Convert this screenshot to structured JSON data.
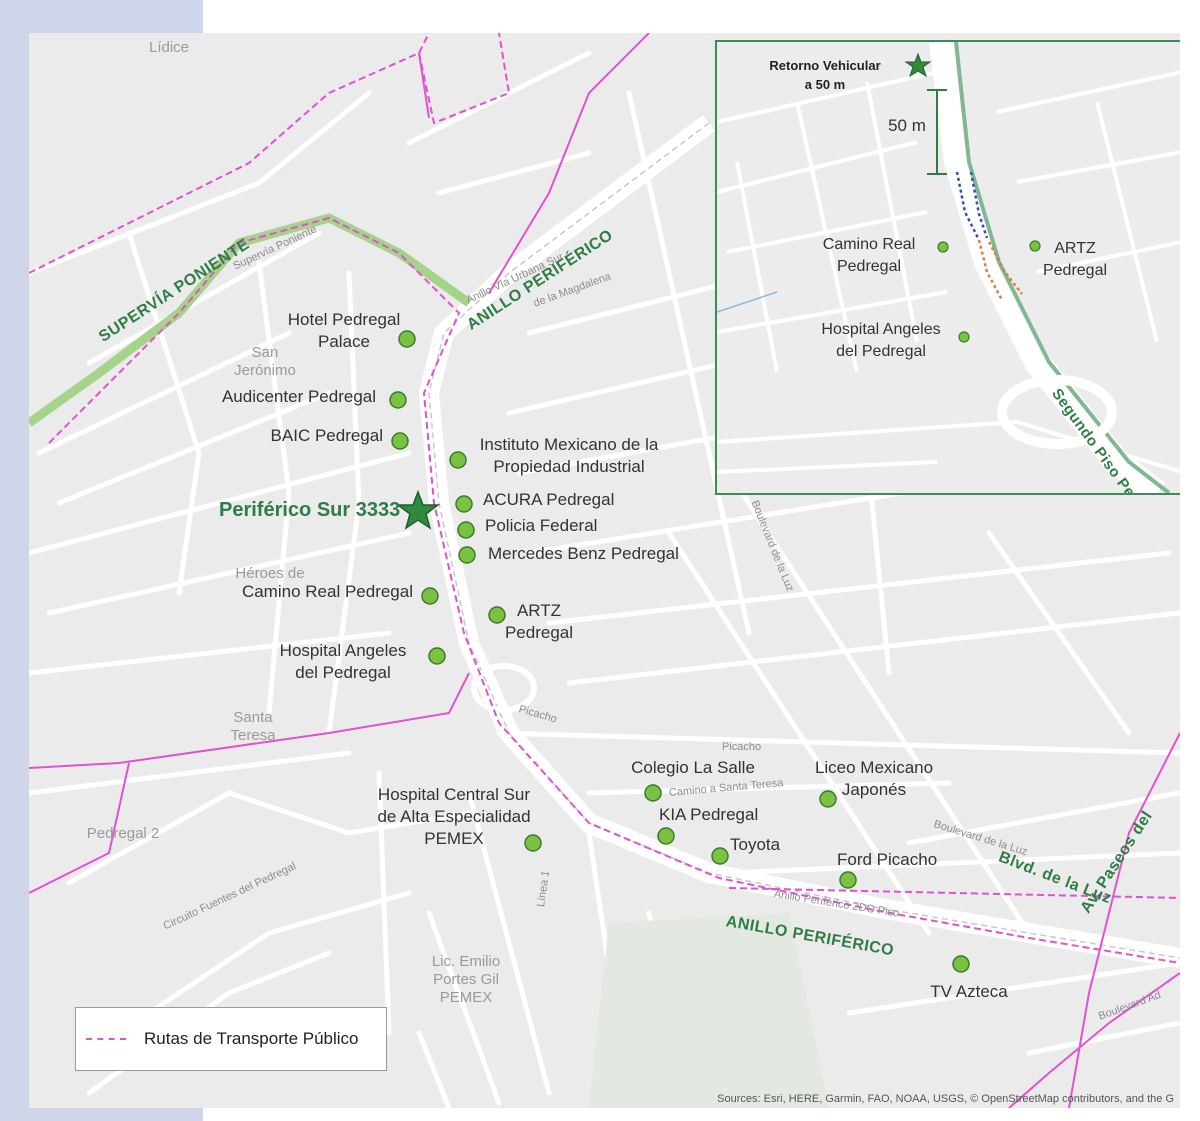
{
  "map": {
    "attribution": "Sources: Esri, HERE, Garmin, FAO, NOAA, USGS, © OpenStreetMap contributors, and the G",
    "colors": {
      "background": "#ebebeb",
      "roads": "#ffffff",
      "poi_marker": "#7cc242",
      "poi_marker_border": "#3a7a2b",
      "transit_route": "#e44fd3",
      "highlight_route": "#a6d38a",
      "label_green": "#2f7d45",
      "side_band": "#cfd6ea"
    },
    "main_location": {
      "label": "Periférico Sur 3333",
      "icon": "star-icon"
    },
    "road_labels": {
      "anillo_north": "ANILLO PERIFÉRICO",
      "anillo_south": "ANILLO PERIFÉRICO",
      "supervia": "SUPERVÍA PONIENTE",
      "blvd_luz": "Blvd. de la Luz",
      "av_paseos": "Av. Paseos del"
    },
    "street_labels": {
      "picacho_1": "Picacho",
      "picacho_2": "Picacho",
      "camino_santa_teresa": "Camino a Santa Teresa",
      "anillo_2do_piso": "Anillo Periférico 2DO Piso",
      "circuito_fuentes": "Circuito Fuentes del Pedregal",
      "linea_1": "Línea 1",
      "boulevard_luz": "Boulevard de la Luz",
      "boulevard_ad": "Boulevard Ad",
      "boulevard_luz_2": "Boulevard de la Luz",
      "supervia_small": "Supervía Poniente",
      "anillo_urbana": "Anillo Vía Urbana Sur",
      "magdalena": "de la Magdalena"
    },
    "areas": {
      "lidice": "Lídice",
      "san_jeronimo": "San\nJerónimo",
      "heroes": "Héroes de",
      "santa_teresa": "Santa\nTeresa",
      "pedregal_2": "Pedregal 2",
      "lic_emilio": "Lic. Emilio\nPortes Gil\nPEMEX"
    },
    "pois": [
      {
        "label": "Hotel Pedregal\nPalace"
      },
      {
        "label": "Audicenter Pedregal"
      },
      {
        "label": "BAIC Pedregal"
      },
      {
        "label": "Instituto Mexicano de la\nPropiedad Industrial"
      },
      {
        "label": "ACURA Pedregal"
      },
      {
        "label": "Policia Federal"
      },
      {
        "label": "Mercedes Benz Pedregal"
      },
      {
        "label": "Camino Real Pedregal"
      },
      {
        "label": "ARTZ\nPedregal"
      },
      {
        "label": "Hospital Angeles\ndel Pedregal"
      },
      {
        "label": "Hospital Central Sur\nde Alta Especialidad\nPEMEX"
      },
      {
        "label": "Colegio La Salle"
      },
      {
        "label": "Liceo Mexicano\nJaponés"
      },
      {
        "label": "KIA Pedregal"
      },
      {
        "label": "Toyota"
      },
      {
        "label": "Ford Picacho"
      },
      {
        "label": "TV Azteca"
      }
    ],
    "inset": {
      "retorno": "Retorno Vehicular\na 50 m",
      "distance": "50 m",
      "camino_real": "Camino Real\nPedregal",
      "artz": "ARTZ\nPedregal",
      "hospital": "Hospital Angeles\ndel Pedregal",
      "segundo_piso": "Segundo Piso Periférico",
      "colors": {
        "route_blue": "#2e4fb5",
        "route_orange": "#e07a3a",
        "highway": "#7fb892"
      }
    },
    "legend": {
      "label": "Rutas de Transporte Público"
    }
  }
}
